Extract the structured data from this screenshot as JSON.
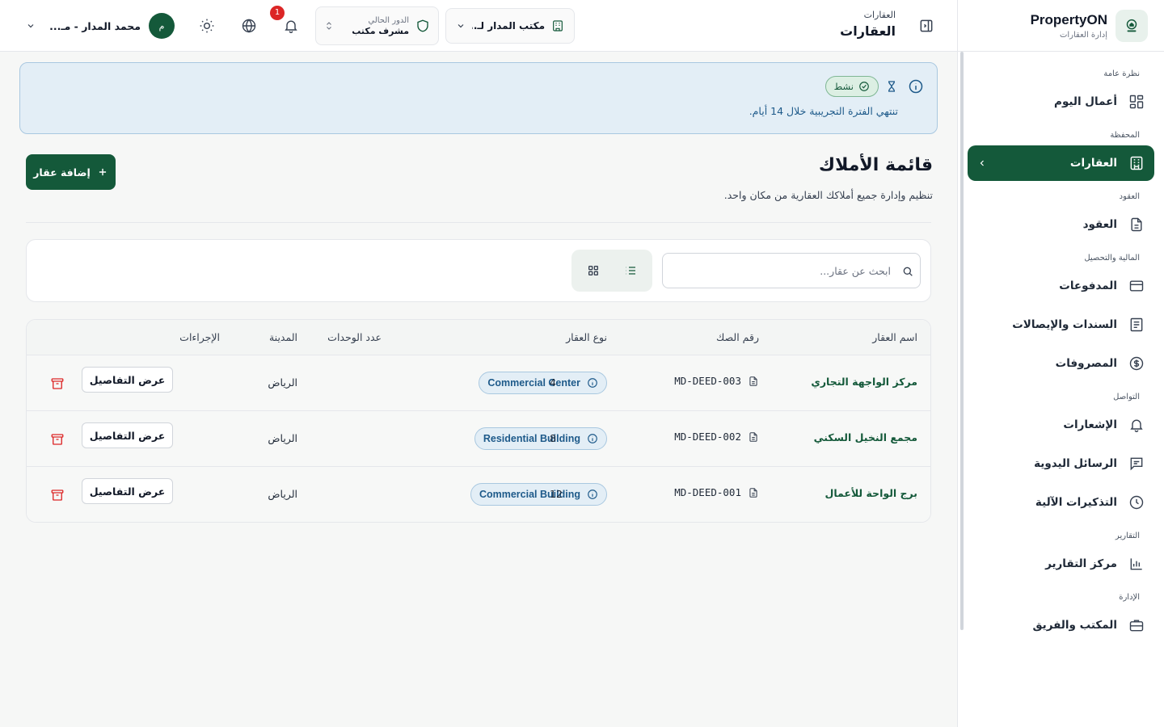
{
  "brand": {
    "name": "PropertyON",
    "subtitle": "إدارة العقارات"
  },
  "sidebar": {
    "groups": [
      {
        "title": "نظرة عامة",
        "items": [
          {
            "label": "أعمال اليوم",
            "icon": "layout-grid-icon"
          }
        ]
      },
      {
        "title": "المحفظة",
        "items": [
          {
            "label": "العقارات",
            "icon": "building-icon",
            "active": true
          }
        ]
      },
      {
        "title": "العقود",
        "items": [
          {
            "label": "العقود",
            "icon": "file-text-icon"
          }
        ]
      },
      {
        "title": "المالية والتحصيل",
        "items": [
          {
            "label": "المدفوعات",
            "icon": "wallet-icon"
          },
          {
            "label": "السندات والإيصالات",
            "icon": "receipt-icon"
          },
          {
            "label": "المصروفات",
            "icon": "dollar-circle-icon"
          }
        ]
      },
      {
        "title": "التواصل",
        "items": [
          {
            "label": "الإشعارات",
            "icon": "bell-icon"
          },
          {
            "label": "الرسائل اليدوية",
            "icon": "message-icon"
          },
          {
            "label": "التذكيرات الآلية",
            "icon": "clock-icon"
          }
        ]
      },
      {
        "title": "التقارير",
        "items": [
          {
            "label": "مركز التقارير",
            "icon": "bar-chart-icon"
          }
        ]
      },
      {
        "title": "الإدارة",
        "items": [
          {
            "label": "المكتب والفريق",
            "icon": "briefcase-icon"
          }
        ]
      }
    ]
  },
  "header": {
    "breadcrumb": "العقارات",
    "title": "العقارات",
    "office": "مكتب المدار لـ...",
    "role_caption": "الدور الحالي",
    "role_value": "مشرف مكتب",
    "notification_count": "1",
    "user_initial": "م",
    "user_name": "محمد المدار - مـ..."
  },
  "trial": {
    "badge": "نشط",
    "message": "تنتهي الفترة التجريبية خلال 14 أيام."
  },
  "page": {
    "title": "قائمة الأملاك",
    "subtitle": "تنظيم وإدارة جميع أملاكك العقارية من مكان واحد.",
    "add_button": "إضافة عقار",
    "search_placeholder": "ابحث عن عقار..."
  },
  "table": {
    "headers": {
      "name": "اسم العقار",
      "deed": "رقم الصك",
      "type": "نوع العقار",
      "units": "عدد الوحدات",
      "city": "المدينة",
      "actions": "الإجراءات"
    },
    "rows": [
      {
        "name": "مركز الواجهة التجاري",
        "deed": "MD-DEED-003",
        "type": "Commercial Center",
        "units": "4",
        "city": "الرياض",
        "action": "عرض التفاصيل"
      },
      {
        "name": "مجمع النخيل السكني",
        "deed": "MD-DEED-002",
        "type": "Residential Building",
        "units": "8",
        "city": "الرياض",
        "action": "عرض التفاصيل"
      },
      {
        "name": "برج الواحة للأعمال",
        "deed": "MD-DEED-001",
        "type": "Commercial Building",
        "units": "12",
        "city": "الرياض",
        "action": "عرض التفاصيل"
      }
    ]
  },
  "colors": {
    "brand": "#14593a",
    "info": "#1e5a8a",
    "danger": "#dc2626"
  }
}
